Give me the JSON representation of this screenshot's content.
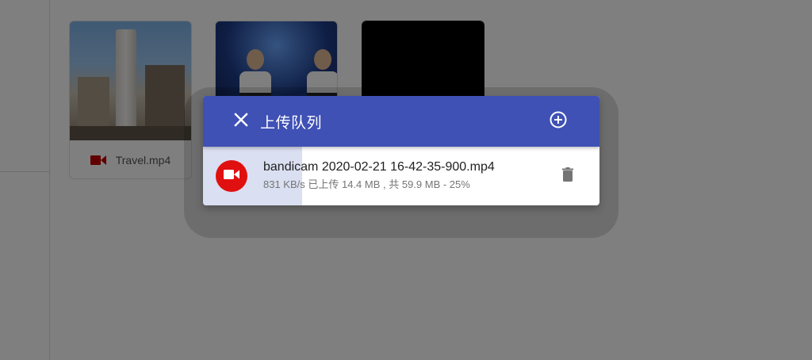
{
  "files": [
    {
      "name": "Travel.mp4",
      "icon": "video-icon"
    },
    {
      "name": "",
      "icon": "video-icon"
    },
    {
      "name": "",
      "icon": "video-icon"
    }
  ],
  "dialog": {
    "title": "上传队列",
    "close_icon": "close-icon",
    "add_icon": "add-circle-icon",
    "item": {
      "name": "bandicam 2020-02-21 16-42-35-900.mp4",
      "status": "831 KB/s 已上传 14.4 MB , 共 59.9 MB - 25%",
      "progress_percent": 25,
      "icon": "videocam-icon",
      "delete_icon": "delete-icon"
    }
  },
  "colors": {
    "header": "#3f51b5",
    "avatar": "#e01010",
    "progress": "#dadff1",
    "file_icon": "#c00000"
  }
}
